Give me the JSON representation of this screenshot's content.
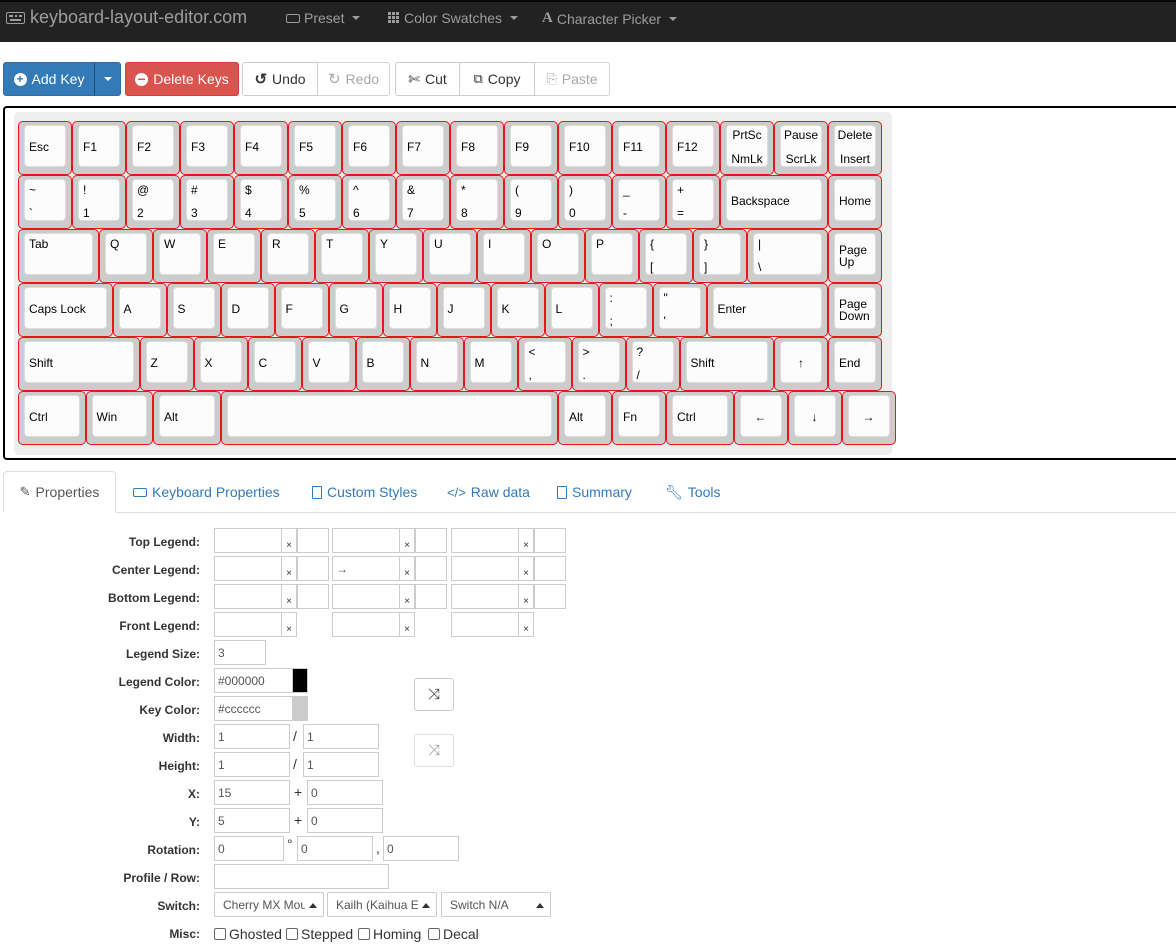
{
  "navbar": {
    "brand": "keyboard-layout-editor.com",
    "items": [
      {
        "label": "Preset",
        "icon": "keyboard-small-icon"
      },
      {
        "label": "Color Swatches",
        "icon": "grid-icon"
      },
      {
        "label": "Character Picker",
        "icon": "font-icon"
      }
    ]
  },
  "toolbar": {
    "add_key": "Add Key",
    "delete_keys": "Delete Keys",
    "undo": "Undo",
    "redo": "Redo",
    "cut": "Cut",
    "copy": "Copy",
    "paste": "Paste"
  },
  "keyboard": {
    "keys": [
      [
        "Esc",
        "F1",
        "F2",
        "F3",
        "F4",
        "F5",
        "F6",
        "F7",
        "F8",
        "F9",
        "F10",
        "F11",
        "F12",
        [
          "PrtSc",
          "NmLk"
        ],
        [
          "Pause",
          "ScrLk"
        ],
        [
          "Delete",
          "Insert"
        ]
      ],
      [
        [
          "~",
          "`"
        ],
        [
          "!",
          "1"
        ],
        [
          "@",
          "2"
        ],
        [
          "#",
          "3"
        ],
        [
          "$",
          "4"
        ],
        [
          "%",
          "5"
        ],
        [
          "^",
          "6"
        ],
        [
          "&",
          "7"
        ],
        [
          "*",
          "8"
        ],
        [
          "(",
          "9"
        ],
        [
          ")",
          "0"
        ],
        [
          "_",
          "-"
        ],
        [
          "+",
          "="
        ],
        "Backspace",
        "Home"
      ],
      [
        "Tab",
        "Q",
        "W",
        "E",
        "R",
        "T",
        "Y",
        "U",
        "I",
        "O",
        "P",
        [
          "{",
          "["
        ],
        [
          "}",
          "]"
        ],
        [
          "|",
          "\\"
        ],
        [
          "Page",
          "Up"
        ]
      ],
      [
        "Caps Lock",
        "A",
        "S",
        "D",
        "F",
        "G",
        "H",
        "J",
        "K",
        "L",
        [
          ":",
          ";"
        ],
        [
          "\"",
          "'"
        ],
        "Enter",
        [
          "Page",
          "Down"
        ]
      ],
      [
        "Shift",
        "Z",
        "X",
        "C",
        "V",
        "B",
        "N",
        "M",
        [
          "<",
          ","
        ],
        [
          ">",
          "."
        ],
        [
          "?",
          "/"
        ],
        "Shift",
        "↑",
        "End"
      ],
      [
        "Ctrl",
        "Win",
        "Alt",
        "",
        "Alt",
        "Fn",
        "Ctrl",
        "←",
        "↓",
        "→"
      ]
    ]
  },
  "tabs": [
    {
      "label": "Properties",
      "icon": "edit-icon",
      "active": true
    },
    {
      "label": "Keyboard Properties",
      "icon": "keyboard-icon",
      "active": false
    },
    {
      "label": "Custom Styles",
      "icon": "file-icon",
      "active": false
    },
    {
      "label": "Raw data",
      "icon": "code-icon",
      "active": false
    },
    {
      "label": "Summary",
      "icon": "list-icon",
      "active": false
    },
    {
      "label": "Tools",
      "icon": "wrench-icon",
      "active": false
    }
  ],
  "properties": {
    "labels": {
      "top_legend": "Top Legend:",
      "center_legend": "Center Legend:",
      "bottom_legend": "Bottom Legend:",
      "front_legend": "Front Legend:",
      "legend_size": "Legend Size:",
      "legend_color": "Legend Color:",
      "key_color": "Key Color:",
      "width": "Width:",
      "height": "Height:",
      "x": "X:",
      "y": "Y:",
      "rotation": "Rotation:",
      "profile_row": "Profile / Row:",
      "switch": "Switch:",
      "misc": "Misc:"
    },
    "x_glyph": "×",
    "center_legend_value": "→",
    "legend_size": "3",
    "legend_color": "#000000",
    "legend_color_swatch": "#000000",
    "key_color": "#cccccc",
    "key_color_swatch": "#cccccc",
    "width": "1",
    "width2": "1",
    "height": "1",
    "height2": "1",
    "x": "15",
    "x_offset": "0",
    "y": "5",
    "y_offset": "0",
    "rotation": "0",
    "rotation_x": "0",
    "rotation_y": "0",
    "profile_row": "",
    "slash": "/",
    "plus": "+",
    "degree": "°",
    "comma": ",",
    "switch_mount": "Cherry MX Mount",
    "switch_brand": "Kailh (Kaihua Electronics)",
    "switch_type": "Switch N/A",
    "misc": {
      "ghosted": "Ghosted",
      "stepped": "Stepped",
      "homing": "Homing",
      "decal": "Decal"
    }
  }
}
